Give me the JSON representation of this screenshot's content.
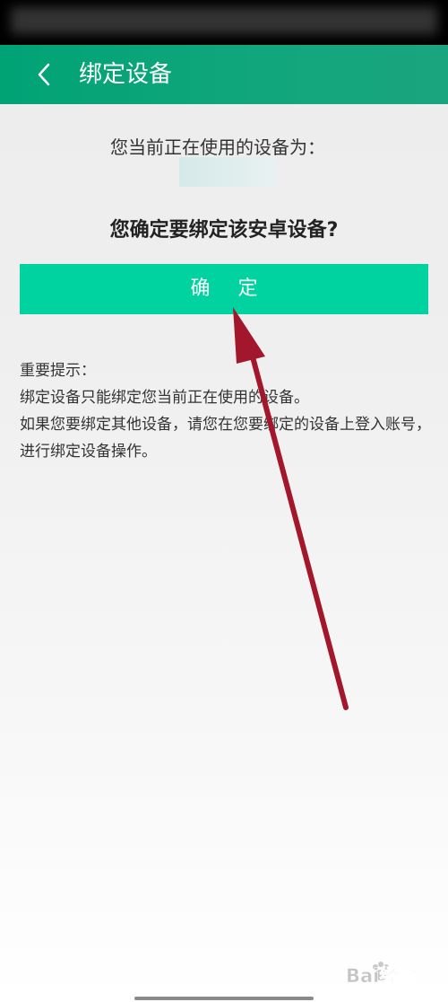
{
  "header": {
    "title": "绑定设备",
    "back_icon": "chevron-left-icon"
  },
  "main": {
    "current_device_label": "您当前正在使用的设备为：",
    "confirm_question": "您确定要绑定该安卓设备?",
    "confirm_button_label": "确 定"
  },
  "notice": {
    "title": "重要提示：",
    "line1": "绑定设备只能绑定您当前正在使用的设备。",
    "line2": "如果您要绑定其他设备，请您在您要绑定的设备上登入账号，进行绑定设备操作。"
  },
  "colors": {
    "header_bg": "#00a375",
    "button_bg": "#00d3a0",
    "annotation_arrow": "#a3172c"
  },
  "watermark": {
    "text": "Bai经验",
    "icon": "baidu-paw-icon"
  }
}
